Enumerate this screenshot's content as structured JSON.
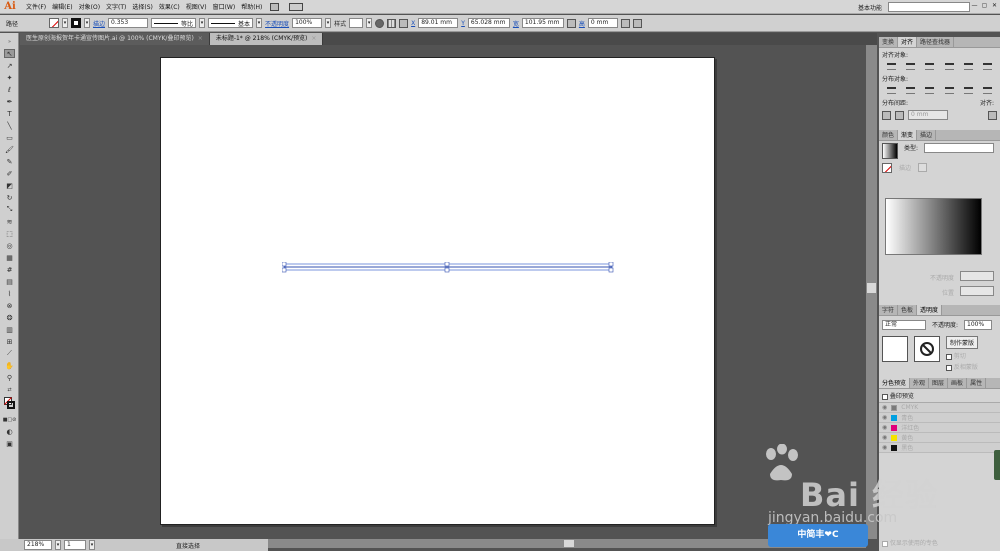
{
  "app": {
    "logo": "Ai"
  },
  "menu": [
    "文件(F)",
    "编辑(E)",
    "对象(O)",
    "文字(T)",
    "选择(S)",
    "效果(C)",
    "视图(V)",
    "窗口(W)",
    "帮助(H)"
  ],
  "workspace": "基本功能",
  "window_buttons": [
    "—",
    "▢",
    "✕"
  ],
  "control": {
    "object_type": "路径",
    "stroke_label": "描边",
    "stroke_weight": "0.353",
    "profile_label": "等比",
    "brush_label": "基本",
    "opacity_label": "不透明度",
    "opacity_value": "100%",
    "style_label": "样式",
    "x_label": "X",
    "x_value": "89.01 mm",
    "y_label": "Y",
    "y_value": "65.028 mm",
    "w_label": "宽",
    "w_value": "101.95 mm",
    "h_label": "高",
    "h_value": "0 mm"
  },
  "tabs": [
    {
      "label": "医生原创海报贺年卡通宣传图片.ai @ 100% (CMYK/叠印预览)",
      "active": false
    },
    {
      "label": "未标题-1* @ 218% (CMYK/预览)",
      "active": true
    }
  ],
  "status": {
    "zoom": "218%",
    "page": "1",
    "tool": "直接选择"
  },
  "align_panel": {
    "tabs": [
      "变换",
      "对齐",
      "路径查找器"
    ],
    "align_objects": "对齐对象:",
    "distribute_objects": "分布对象:",
    "distribute_spacing": "分布间距:",
    "align_to": "对齐:",
    "spacing_value": "0 mm"
  },
  "gradient_panel": {
    "tabs": [
      "颜色",
      "渐变",
      "描边"
    ],
    "type_label": "类型:",
    "stroke_label": "描边",
    "opacity_label": "不透明度",
    "location_label": "位置"
  },
  "transparency_panel": {
    "tabs": [
      "字符",
      "色板",
      "透明度"
    ],
    "blend_mode": "正常",
    "opacity_label": "不透明度:",
    "opacity_value": "100%",
    "make_mask": "制作蒙版",
    "clip_label": "剪切",
    "invert_label": "反相蒙版"
  },
  "separations_panel": {
    "tabs": [
      "分色预览",
      "外观",
      "图层",
      "画板",
      "属性"
    ],
    "overprint_label": "叠印预览",
    "inks": [
      {
        "name": "CMYK",
        "color": "#7a7a7a"
      },
      {
        "name": "青色",
        "color": "#00a0e0"
      },
      {
        "name": "洋红色",
        "color": "#e0007a"
      },
      {
        "name": "黄色",
        "color": "#f5e400"
      },
      {
        "name": "黑色",
        "color": "#111111"
      }
    ],
    "footer": "仅显示使用的专色"
  },
  "watermark": {
    "brand": "Bai 经验",
    "url": "jingyan.baidu.com",
    "badge": "中简丰❤C"
  }
}
